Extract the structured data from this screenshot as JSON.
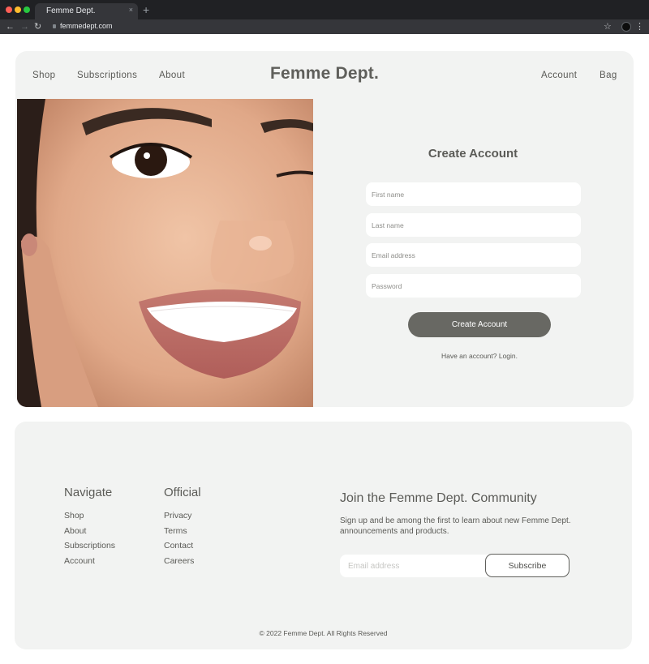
{
  "browser": {
    "tab_title": "Femme Dept.",
    "tab_close": "×",
    "new_tab": "+",
    "url": "femmedept.com"
  },
  "header": {
    "nav_left": [
      "Shop",
      "Subscriptions",
      "About"
    ],
    "brand": "Femme Dept.",
    "nav_right": [
      "Account",
      "Bag"
    ]
  },
  "form": {
    "title": "Create Account",
    "first_name_placeholder": "First name",
    "last_name_placeholder": "Last name",
    "email_placeholder": "Email address",
    "password_placeholder": "Password",
    "submit_label": "Create Account",
    "login_prompt": "Have an account? Login."
  },
  "footer": {
    "navigate_heading": "Navigate",
    "navigate_links": [
      "Shop",
      "About",
      "Subscriptions",
      "Account"
    ],
    "official_heading": "Official",
    "official_links": [
      "Privacy",
      "Terms",
      "Contact",
      "Careers"
    ],
    "join_title": "Join the Femme Dept. Community",
    "join_text": "Sign up and be among the first to learn about new Femme Dept. announcements and products.",
    "email_placeholder": "Email address",
    "subscribe_label": "Subscribe",
    "copyright": "© 2022 Femme Dept. All Rights Reserved"
  },
  "colors": {
    "background": "#f2f3f2",
    "button": "#686863",
    "text": "#5f5f5b"
  }
}
